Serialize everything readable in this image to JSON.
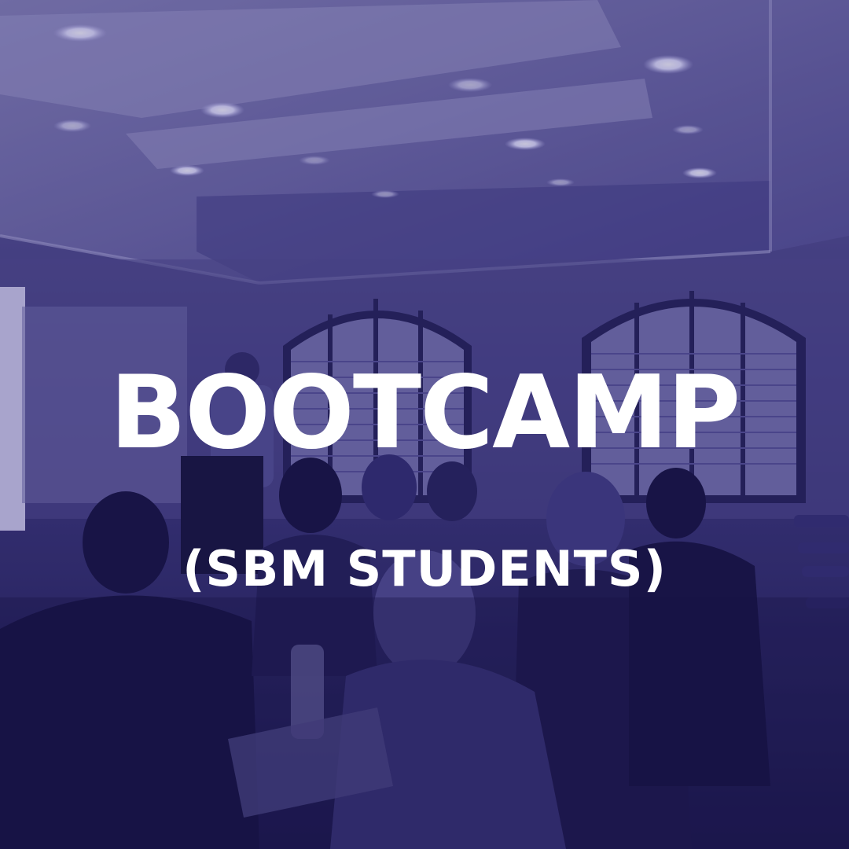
{
  "photo": {
    "description_icon": "classroom-presentation-photo",
    "tint_color": "#322c79"
  },
  "headline": "BOOTCAMP",
  "subheadline": "(SBM STUDENTS)"
}
